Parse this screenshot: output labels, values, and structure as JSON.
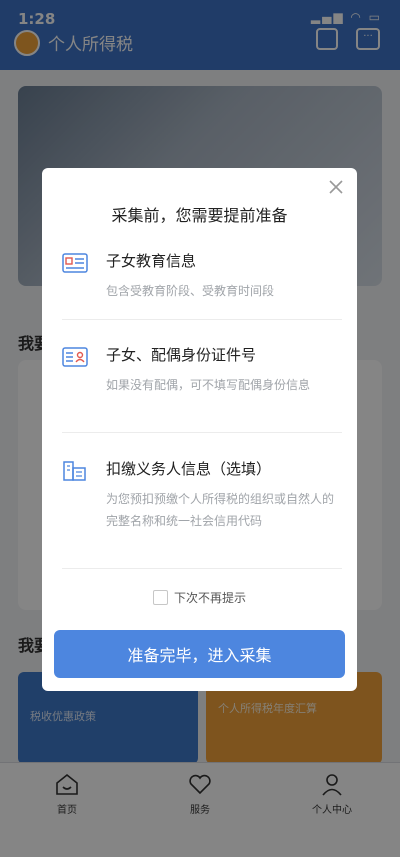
{
  "status": {
    "time": "1:28",
    "icons": "▂▄▆ ◠ ▭"
  },
  "header": {
    "title": "个人所得税"
  },
  "background": {
    "section1_title": "我要",
    "section2_title": "我要",
    "promo_left": "税收优惠政策",
    "promo_right": "个人所得税年度汇算"
  },
  "modal": {
    "title": "采集前，您需要提前准备",
    "items": [
      {
        "title": "子女教育信息",
        "desc": "包含受教育阶段、受教育时间段"
      },
      {
        "title": "子女、配偶身份证件号",
        "desc": "如果没有配偶，可不填写配偶身份信息"
      },
      {
        "title": "扣缴义务人信息（选填）",
        "desc": "为您预扣预缴个人所得税的组织或自然人的完整名称和统一社会信用代码"
      }
    ],
    "checkbox_label": "下次不再提示",
    "confirm_button": "准备完毕，进入采集"
  },
  "tabs": [
    {
      "label": "首页"
    },
    {
      "label": "服务"
    },
    {
      "label": "个人中心"
    }
  ],
  "colors": {
    "primary": "#4d86df",
    "header": "#3f74c8",
    "promo_orange": "#f2a23b"
  }
}
